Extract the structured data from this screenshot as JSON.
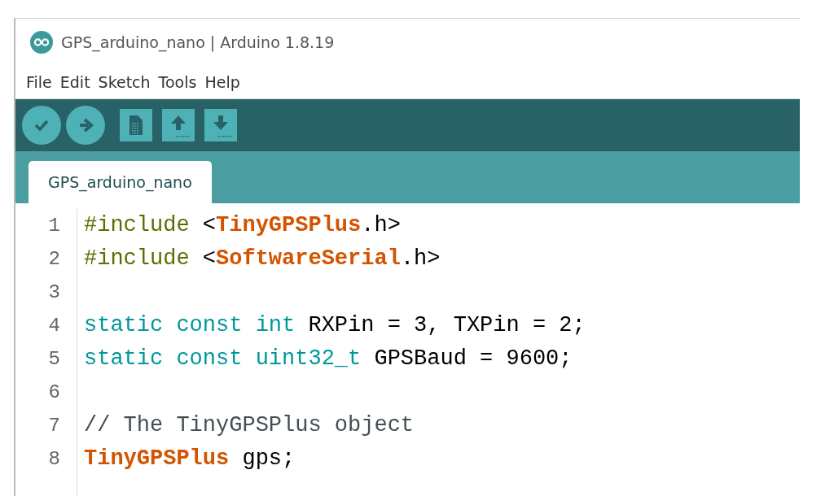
{
  "window": {
    "title": "GPS_arduino_nano | Arduino 1.8.19"
  },
  "menu": [
    "File",
    "Edit",
    "Sketch",
    "Tools",
    "Help"
  ],
  "tabs": [
    {
      "label": "GPS_arduino_nano",
      "selected": true
    }
  ],
  "editor": {
    "lines": [
      {
        "number": "1",
        "tokens": [
          {
            "kind": "preprocessor",
            "text": "#include"
          },
          {
            "kind": "plain",
            "text": " <"
          },
          {
            "kind": "class",
            "text": "TinyGPSPlus"
          },
          {
            "kind": "plain",
            "text": ".h>"
          }
        ]
      },
      {
        "number": "2",
        "tokens": [
          {
            "kind": "preprocessor",
            "text": "#include"
          },
          {
            "kind": "plain",
            "text": " <"
          },
          {
            "kind": "class",
            "text": "SoftwareSerial"
          },
          {
            "kind": "plain",
            "text": ".h>"
          }
        ]
      },
      {
        "number": "3"
      },
      {
        "number": "4",
        "tokens": [
          {
            "kind": "keyword",
            "text": "static const int"
          },
          {
            "kind": "plain",
            "text": " RXPin = 3, TXPin = 2;"
          }
        ]
      },
      {
        "number": "5",
        "tokens": [
          {
            "kind": "keyword",
            "text": "static const uint32_t"
          },
          {
            "kind": "plain",
            "text": " GPSBaud = 9600;"
          }
        ]
      },
      {
        "number": "6"
      },
      {
        "number": "7",
        "tokens": [
          {
            "kind": "comment",
            "text": "// The TinyGPSPlus object"
          }
        ]
      },
      {
        "number": "8",
        "tokens": [
          {
            "kind": "class",
            "text": "TinyGPSPlus"
          },
          {
            "kind": "plain",
            "text": " gps;"
          }
        ]
      }
    ]
  }
}
